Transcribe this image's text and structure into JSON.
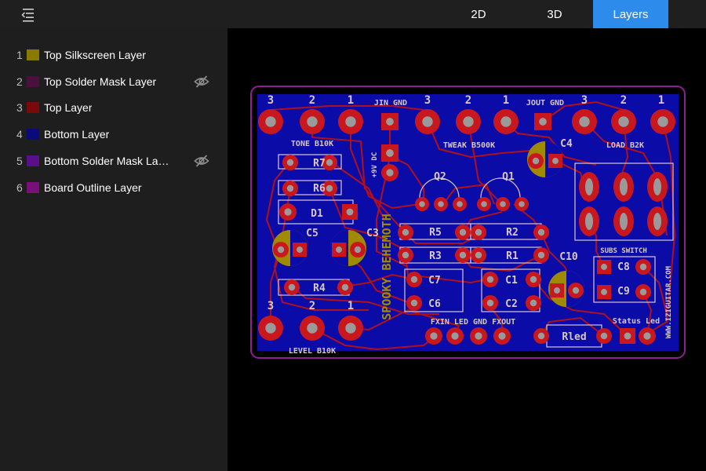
{
  "header": {
    "tabs": [
      {
        "label": "2D",
        "active": false
      },
      {
        "label": "3D",
        "active": false
      },
      {
        "label": "Layers",
        "active": true
      }
    ],
    "accent_color": "#2d8ceb"
  },
  "sidebar": {
    "layers": [
      {
        "index": "1",
        "name": "Top Silkscreen Layer",
        "color": "#8a7a00",
        "hidden": false
      },
      {
        "index": "2",
        "name": "Top Solder Mask Layer",
        "color": "#4a0f3c",
        "hidden": true
      },
      {
        "index": "3",
        "name": "Top Layer",
        "color": "#7a0a0a",
        "hidden": false
      },
      {
        "index": "4",
        "name": "Bottom Layer",
        "color": "#0a0a7a",
        "hidden": false
      },
      {
        "index": "5",
        "name": "Bottom Solder Mask La…",
        "color": "#5a0f8a",
        "hidden": true
      },
      {
        "index": "6",
        "name": "Board Outline Layer",
        "color": "#7a0f7a",
        "hidden": false
      }
    ]
  },
  "board": {
    "colors": {
      "copper_bottom": "#0b0ba8",
      "copper_top": "#b0101a",
      "pad": "#c8181e",
      "pad_hole": "#9a9a9a",
      "silkscreen": "#d8c8c8",
      "outline": "#8e1f8e",
      "electrolytic": "#a08a00"
    },
    "labels": {
      "jin_gnd": "JIN GND",
      "jout_gnd": "JOUT GND",
      "tone": "TONE B10K",
      "tweak": "TWEAK B500K",
      "load": "LOAD B2K",
      "level": "LEVEL B10K",
      "dc": "+9V DC",
      "brand": "SPOOKY BEHEMOTH",
      "subs_switch": "SUBS SWITCH",
      "fx_row": "FXIN  LED  GND FXOUT",
      "status_led": "Status Led",
      "website": "WWW.IZIGUITAR.COM",
      "pot_nums": [
        "3",
        "2",
        "1"
      ],
      "r7": "R7",
      "r6": "R6",
      "d1": "D1",
      "c5": "C5",
      "c3": "C3",
      "r4": "R4",
      "q2": "Q2",
      "q1": "Q1",
      "c4": "C4",
      "r5": "R5",
      "r2": "R2",
      "r3": "R3",
      "r1": "R1",
      "c7": "C7",
      "c1": "C1",
      "c6": "C6",
      "c2": "C2",
      "c10": "C10",
      "c8": "C8",
      "c9": "C9",
      "rled": "Rled"
    }
  }
}
